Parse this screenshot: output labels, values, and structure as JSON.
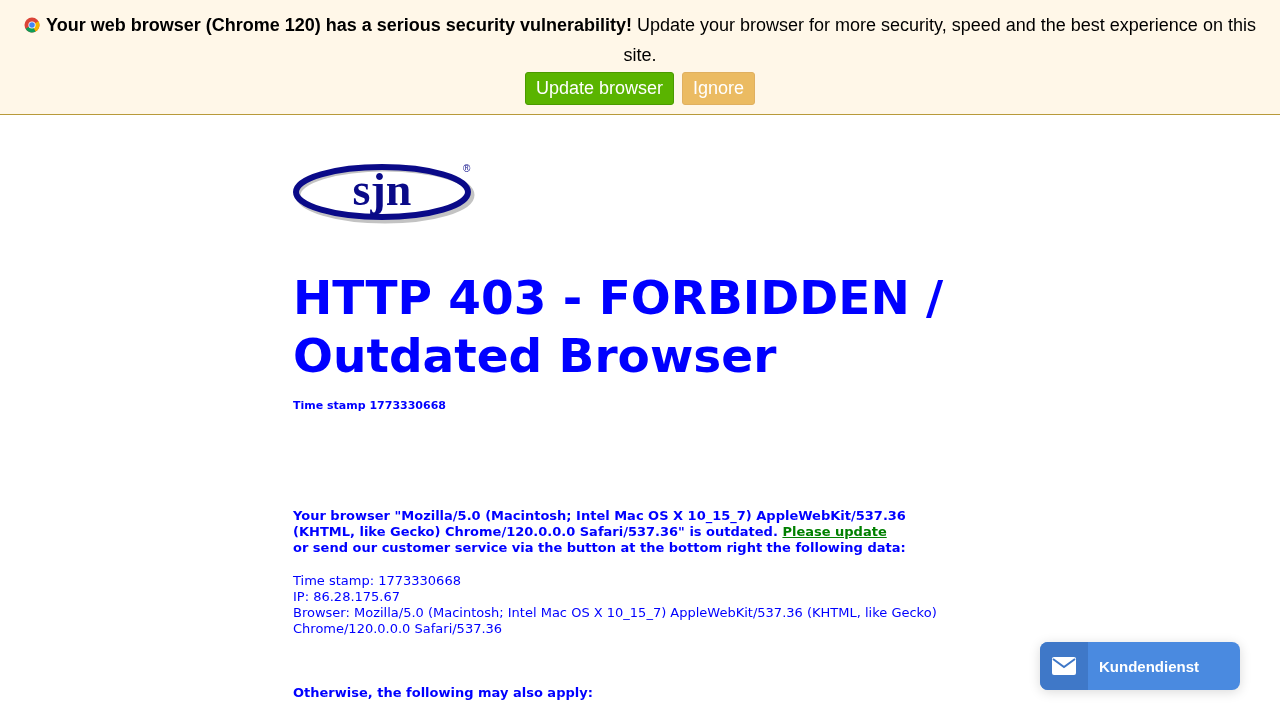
{
  "banner": {
    "message": "**Your web browser (Chrome 120) has a serious security vulnerability!** Update your browser for more security, speed and the best experience on this site.",
    "buttons": [
      {
        "label": "Update browser",
        "kind": "primary"
      },
      {
        "label": "Ignore",
        "kind": "secondary"
      }
    ]
  },
  "logo": {
    "text": "sjn",
    "mark": "®"
  },
  "title": "HTTP 403 - FORBIDDEN / Outdated Browser",
  "time_stamp": "Time stamp 1773330668",
  "notice": {
    "text": "Your browser \"Mozilla/5.0 (Macintosh; Intel Mac OS X 10_15_7) AppleWebKit/537.36 (KHTML, like Gecko) Chrome/120.0.0.0 Safari/537.36\" is outdated.",
    "link": "Please update",
    "after": "or send our customer service via the button at the bottom right the following data:"
  },
  "data_lines": [
    "Time stamp: 1773330668",
    "IP: 86.28.175.67",
    "Browser: Mozilla/5.0 (Macintosh; Intel Mac OS X 10_15_7) AppleWebKit/537.36 (KHTML, like Gecko) Chrome/120.0.0.0 Safari/537.36"
  ],
  "otherwise": "Otherwise, the following may also apply:",
  "support_button": {
    "label": "Kundendienst"
  }
}
